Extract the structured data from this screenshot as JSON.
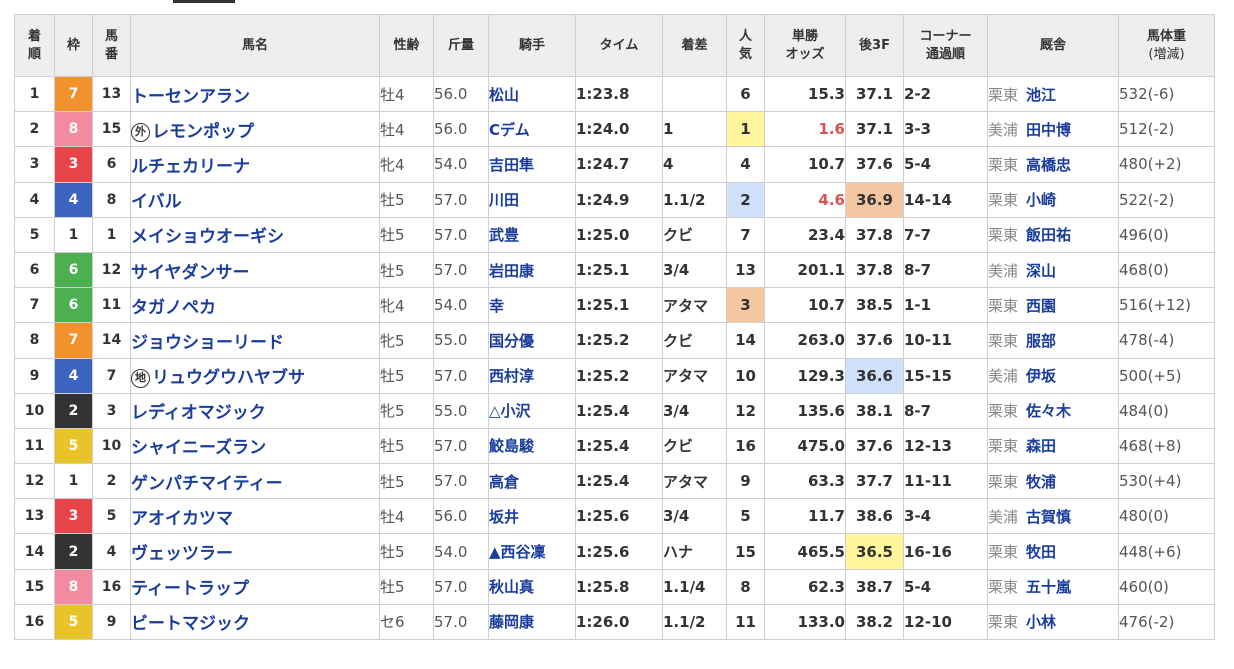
{
  "headers": {
    "pos": [
      "着",
      "順"
    ],
    "waku": "枠",
    "umaban": [
      "馬",
      "番"
    ],
    "horse": "馬名",
    "sex": "性齢",
    "weight": "斤量",
    "jockey": "騎手",
    "time": "タイム",
    "margin": "着差",
    "pop": [
      "人",
      "気"
    ],
    "odds": [
      "単勝",
      "オッズ"
    ],
    "last3f": "後3F",
    "corner": [
      "コーナー",
      "通過順"
    ],
    "stable": "厩舎",
    "bw": [
      "馬体重",
      "(増減)"
    ]
  },
  "colors": {
    "waku1": "#ffffff",
    "waku2": "#333333",
    "waku3": "#e8454a",
    "waku4": "#3c64c0",
    "waku5": "#e8c42a",
    "waku6": "#4caf50",
    "waku7": "#f2922c",
    "waku8": "#f28aa0",
    "highlight_yellow": "#fff59d",
    "highlight_blue": "#cfe0fb",
    "highlight_orange": "#f4c7a1"
  },
  "rows": [
    {
      "pos": "1",
      "waku": "7",
      "umaban": "13",
      "badge": "",
      "horse": "トーセンアラン",
      "sex": "牡4",
      "weight": "56.0",
      "jockey": "松山",
      "time": "1:23.8",
      "margin": "",
      "pop": "6",
      "odds": "15.3",
      "odds_red": false,
      "last3f": "37.1",
      "corner": "2-2",
      "region": "栗東",
      "trainer": "池江",
      "bw": "532(-6)",
      "pop_hl": "",
      "last3f_hl": ""
    },
    {
      "pos": "2",
      "waku": "8",
      "umaban": "15",
      "badge": "外",
      "horse": "レモンポップ",
      "sex": "牡4",
      "weight": "56.0",
      "jockey": "Cデム",
      "time": "1:24.0",
      "margin": "1",
      "pop": "1",
      "odds": "1.6",
      "odds_red": true,
      "last3f": "37.1",
      "corner": "3-3",
      "region": "美浦",
      "trainer": "田中博",
      "bw": "512(-2)",
      "pop_hl": "yellow",
      "last3f_hl": ""
    },
    {
      "pos": "3",
      "waku": "3",
      "umaban": "6",
      "badge": "",
      "horse": "ルチェカリーナ",
      "sex": "牝4",
      "weight": "54.0",
      "jockey": "吉田隼",
      "time": "1:24.7",
      "margin": "4",
      "pop": "4",
      "odds": "10.7",
      "odds_red": false,
      "last3f": "37.6",
      "corner": "5-4",
      "region": "栗東",
      "trainer": "高橋忠",
      "bw": "480(+2)",
      "pop_hl": "",
      "last3f_hl": ""
    },
    {
      "pos": "4",
      "waku": "4",
      "umaban": "8",
      "badge": "",
      "horse": "イバル",
      "sex": "牡5",
      "weight": "57.0",
      "jockey": "川田",
      "time": "1:24.9",
      "margin": "1.1/2",
      "pop": "2",
      "odds": "4.6",
      "odds_red": true,
      "last3f": "36.9",
      "corner": "14-14",
      "region": "栗東",
      "trainer": "小崎",
      "bw": "522(-2)",
      "pop_hl": "blue",
      "last3f_hl": "orange"
    },
    {
      "pos": "5",
      "waku": "1",
      "umaban": "1",
      "badge": "",
      "horse": "メイショウオーギシ",
      "sex": "牡5",
      "weight": "57.0",
      "jockey": "武豊",
      "time": "1:25.0",
      "margin": "クビ",
      "pop": "7",
      "odds": "23.4",
      "odds_red": false,
      "last3f": "37.8",
      "corner": "7-7",
      "region": "栗東",
      "trainer": "飯田祐",
      "bw": "496(0)",
      "pop_hl": "",
      "last3f_hl": ""
    },
    {
      "pos": "6",
      "waku": "6",
      "umaban": "12",
      "badge": "",
      "horse": "サイヤダンサー",
      "sex": "牡5",
      "weight": "57.0",
      "jockey": "岩田康",
      "time": "1:25.1",
      "margin": "3/4",
      "pop": "13",
      "odds": "201.1",
      "odds_red": false,
      "last3f": "37.8",
      "corner": "8-7",
      "region": "美浦",
      "trainer": "深山",
      "bw": "468(0)",
      "pop_hl": "",
      "last3f_hl": ""
    },
    {
      "pos": "7",
      "waku": "6",
      "umaban": "11",
      "badge": "",
      "horse": "タガノペカ",
      "sex": "牝4",
      "weight": "54.0",
      "jockey": "幸",
      "time": "1:25.1",
      "margin": "アタマ",
      "pop": "3",
      "odds": "10.7",
      "odds_red": false,
      "last3f": "38.5",
      "corner": "1-1",
      "region": "栗東",
      "trainer": "西園",
      "bw": "516(+12)",
      "pop_hl": "orange",
      "last3f_hl": ""
    },
    {
      "pos": "8",
      "waku": "7",
      "umaban": "14",
      "badge": "",
      "horse": "ジョウショーリード",
      "sex": "牝5",
      "weight": "55.0",
      "jockey": "国分優",
      "time": "1:25.2",
      "margin": "クビ",
      "pop": "14",
      "odds": "263.0",
      "odds_red": false,
      "last3f": "37.6",
      "corner": "10-11",
      "region": "栗東",
      "trainer": "服部",
      "bw": "478(-4)",
      "pop_hl": "",
      "last3f_hl": ""
    },
    {
      "pos": "9",
      "waku": "4",
      "umaban": "7",
      "badge": "地",
      "horse": "リュウグウハヤブサ",
      "sex": "牡5",
      "weight": "57.0",
      "jockey": "西村淳",
      "time": "1:25.2",
      "margin": "アタマ",
      "pop": "10",
      "odds": "129.3",
      "odds_red": false,
      "last3f": "36.6",
      "corner": "15-15",
      "region": "美浦",
      "trainer": "伊坂",
      "bw": "500(+5)",
      "pop_hl": "",
      "last3f_hl": "blue"
    },
    {
      "pos": "10",
      "waku": "2",
      "umaban": "3",
      "badge": "",
      "horse": "レディオマジック",
      "sex": "牝5",
      "weight": "55.0",
      "jockey": "△小沢",
      "time": "1:25.4",
      "margin": "3/4",
      "pop": "12",
      "odds": "135.6",
      "odds_red": false,
      "last3f": "38.1",
      "corner": "8-7",
      "region": "栗東",
      "trainer": "佐々木",
      "bw": "484(0)",
      "pop_hl": "",
      "last3f_hl": ""
    },
    {
      "pos": "11",
      "waku": "5",
      "umaban": "10",
      "badge": "",
      "horse": "シャイニーズラン",
      "sex": "牡5",
      "weight": "57.0",
      "jockey": "鮫島駿",
      "time": "1:25.4",
      "margin": "クビ",
      "pop": "16",
      "odds": "475.0",
      "odds_red": false,
      "last3f": "37.6",
      "corner": "12-13",
      "region": "栗東",
      "trainer": "森田",
      "bw": "468(+8)",
      "pop_hl": "",
      "last3f_hl": ""
    },
    {
      "pos": "12",
      "waku": "1",
      "umaban": "2",
      "badge": "",
      "horse": "ゲンパチマイティー",
      "sex": "牡5",
      "weight": "57.0",
      "jockey": "高倉",
      "time": "1:25.4",
      "margin": "アタマ",
      "pop": "9",
      "odds": "63.3",
      "odds_red": false,
      "last3f": "37.7",
      "corner": "11-11",
      "region": "栗東",
      "trainer": "牧浦",
      "bw": "530(+4)",
      "pop_hl": "",
      "last3f_hl": ""
    },
    {
      "pos": "13",
      "waku": "3",
      "umaban": "5",
      "badge": "",
      "horse": "アオイカツマ",
      "sex": "牡4",
      "weight": "56.0",
      "jockey": "坂井",
      "time": "1:25.6",
      "margin": "3/4",
      "pop": "5",
      "odds": "11.7",
      "odds_red": false,
      "last3f": "38.6",
      "corner": "3-4",
      "region": "美浦",
      "trainer": "古賀慎",
      "bw": "480(0)",
      "pop_hl": "",
      "last3f_hl": ""
    },
    {
      "pos": "14",
      "waku": "2",
      "umaban": "4",
      "badge": "",
      "horse": "ヴェッツラー",
      "sex": "牡5",
      "weight": "54.0",
      "jockey": "▲西谷凜",
      "time": "1:25.6",
      "margin": "ハナ",
      "pop": "15",
      "odds": "465.5",
      "odds_red": false,
      "last3f": "36.5",
      "corner": "16-16",
      "region": "栗東",
      "trainer": "牧田",
      "bw": "448(+6)",
      "pop_hl": "",
      "last3f_hl": "yellow"
    },
    {
      "pos": "15",
      "waku": "8",
      "umaban": "16",
      "badge": "",
      "horse": "ティートラップ",
      "sex": "牡5",
      "weight": "57.0",
      "jockey": "秋山真",
      "time": "1:25.8",
      "margin": "1.1/4",
      "pop": "8",
      "odds": "62.3",
      "odds_red": false,
      "last3f": "38.7",
      "corner": "5-4",
      "region": "栗東",
      "trainer": "五十嵐",
      "bw": "460(0)",
      "pop_hl": "",
      "last3f_hl": ""
    },
    {
      "pos": "16",
      "waku": "5",
      "umaban": "9",
      "badge": "",
      "horse": "ビートマジック",
      "sex": "セ6",
      "weight": "57.0",
      "jockey": "藤岡康",
      "time": "1:26.0",
      "margin": "1.1/2",
      "pop": "11",
      "odds": "133.0",
      "odds_red": false,
      "last3f": "38.2",
      "corner": "12-10",
      "region": "栗東",
      "trainer": "小林",
      "bw": "476(-2)",
      "pop_hl": "",
      "last3f_hl": ""
    }
  ]
}
